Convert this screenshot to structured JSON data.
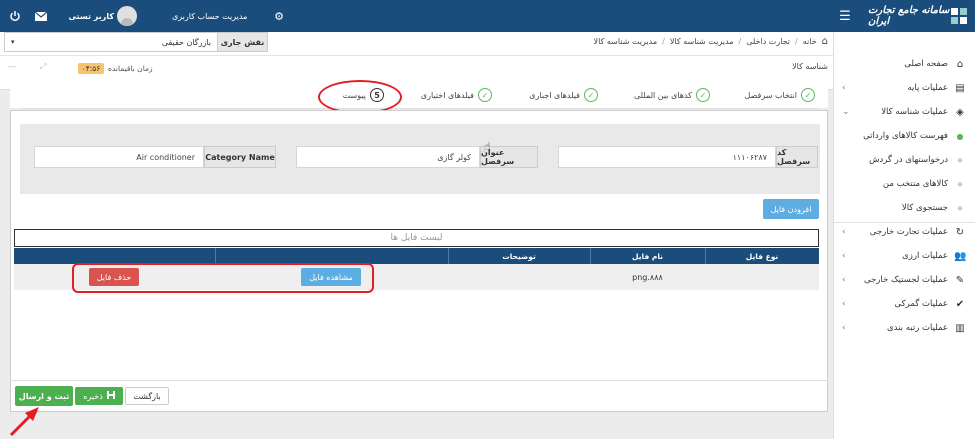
{
  "topbar": {
    "brand": "سامانه جامع تجارت ایران",
    "account_mgmt": "مدیریت حساب کاربری",
    "user_name": "کاربر تستی"
  },
  "sidebar": {
    "items": [
      {
        "label": "صفحه اصلی",
        "icon": "home-icon"
      },
      {
        "label": "عملیات پایه",
        "icon": "chart-icon"
      },
      {
        "label": "عملیات شناسه کالا",
        "icon": "cubes-icon"
      },
      {
        "label": "فهرست کالاهای وارداتی"
      },
      {
        "label": "درخواستهای در گردش"
      },
      {
        "label": "کالاهای منتخب من"
      },
      {
        "label": "جستجوی کالا"
      },
      {
        "label": "عملیات تجارت خارجی",
        "icon": "refresh-icon"
      },
      {
        "label": "عملیات ارزی",
        "icon": "users-icon"
      },
      {
        "label": "عملیات لجستیک خارجی",
        "icon": "edit-icon"
      },
      {
        "label": "عملیات گمرکی",
        "icon": "check-icon"
      },
      {
        "label": "عملیات رتبه بندی",
        "icon": "bar-chart-icon"
      }
    ]
  },
  "breadcrumb": {
    "home": "خانه",
    "item1": "تجارت داخلی",
    "item2": "مدیریت شناسه کالا",
    "current": "مدیریت شناسه کالا"
  },
  "role": {
    "label": "نقش جاری",
    "value": "بازرگان حقیقی"
  },
  "page_title": "شناسه کالا",
  "timer": {
    "label": "زمان باقیمانده",
    "value": "۰۴:۵۶"
  },
  "steps": [
    {
      "label": "انتخاب سرفصل"
    },
    {
      "label": "کدهای بین المللی"
    },
    {
      "label": "فیلدهای اجباری"
    },
    {
      "label": "فیلدهای اختیاری"
    },
    {
      "label": "پیوست",
      "number": "5"
    }
  ],
  "form": {
    "code_label": "کد سرفصل",
    "code_value": "۱۱۱۰۶۲۸۷",
    "title_label": "عنوان سرفصل",
    "title_value": "کولر گازی",
    "category_label": "Category Name",
    "category_value": "Air conditioner"
  },
  "add_file_button": "افزودن فایل",
  "file_list": {
    "title": "لیست فایل ها",
    "headers": [
      "نوع فایل",
      "نام فایل",
      "توضیحات"
    ],
    "rows": [
      {
        "type": "",
        "name": "png.۸۸۸",
        "description": "",
        "view": "مشاهده فایل",
        "delete": "حذف فایل"
      }
    ]
  },
  "footer": {
    "back": "بازگشت",
    "save": "ذخیره",
    "submit": "ثبت و ارسال"
  },
  "colors": {
    "topbar": "#1a4d7c",
    "table_header": "#1a4d7c",
    "green": "#4caf50",
    "blue": "#5dade2",
    "red": "#d9534f",
    "annotation": "#e31e24"
  }
}
